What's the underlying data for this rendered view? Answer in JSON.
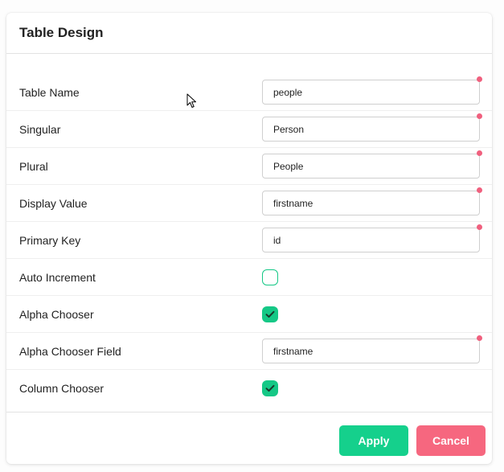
{
  "panel": {
    "title": "Table Design"
  },
  "form": {
    "table_name": {
      "label": "Table Name",
      "value": "people",
      "required": true
    },
    "singular": {
      "label": "Singular",
      "value": "Person",
      "required": true
    },
    "plural": {
      "label": "Plural",
      "value": "People",
      "required": true
    },
    "display_value": {
      "label": "Display Value",
      "value": "firstname",
      "required": true
    },
    "primary_key": {
      "label": "Primary Key",
      "value": "id",
      "required": true
    },
    "auto_increment": {
      "label": "Auto Increment",
      "checked": false
    },
    "alpha_chooser": {
      "label": "Alpha Chooser",
      "checked": true
    },
    "alpha_chooser_field": {
      "label": "Alpha Chooser Field",
      "value": "firstname",
      "required": true
    },
    "column_chooser": {
      "label": "Column Chooser",
      "checked": true
    }
  },
  "footer": {
    "apply_label": "Apply",
    "cancel_label": "Cancel"
  },
  "colors": {
    "accent_green": "#15d08c",
    "accent_red": "#f6677f",
    "required_dot": "#f0607e"
  },
  "icons": {
    "checkbox_checked": "check-icon",
    "cursor": "mouse-pointer-icon"
  }
}
